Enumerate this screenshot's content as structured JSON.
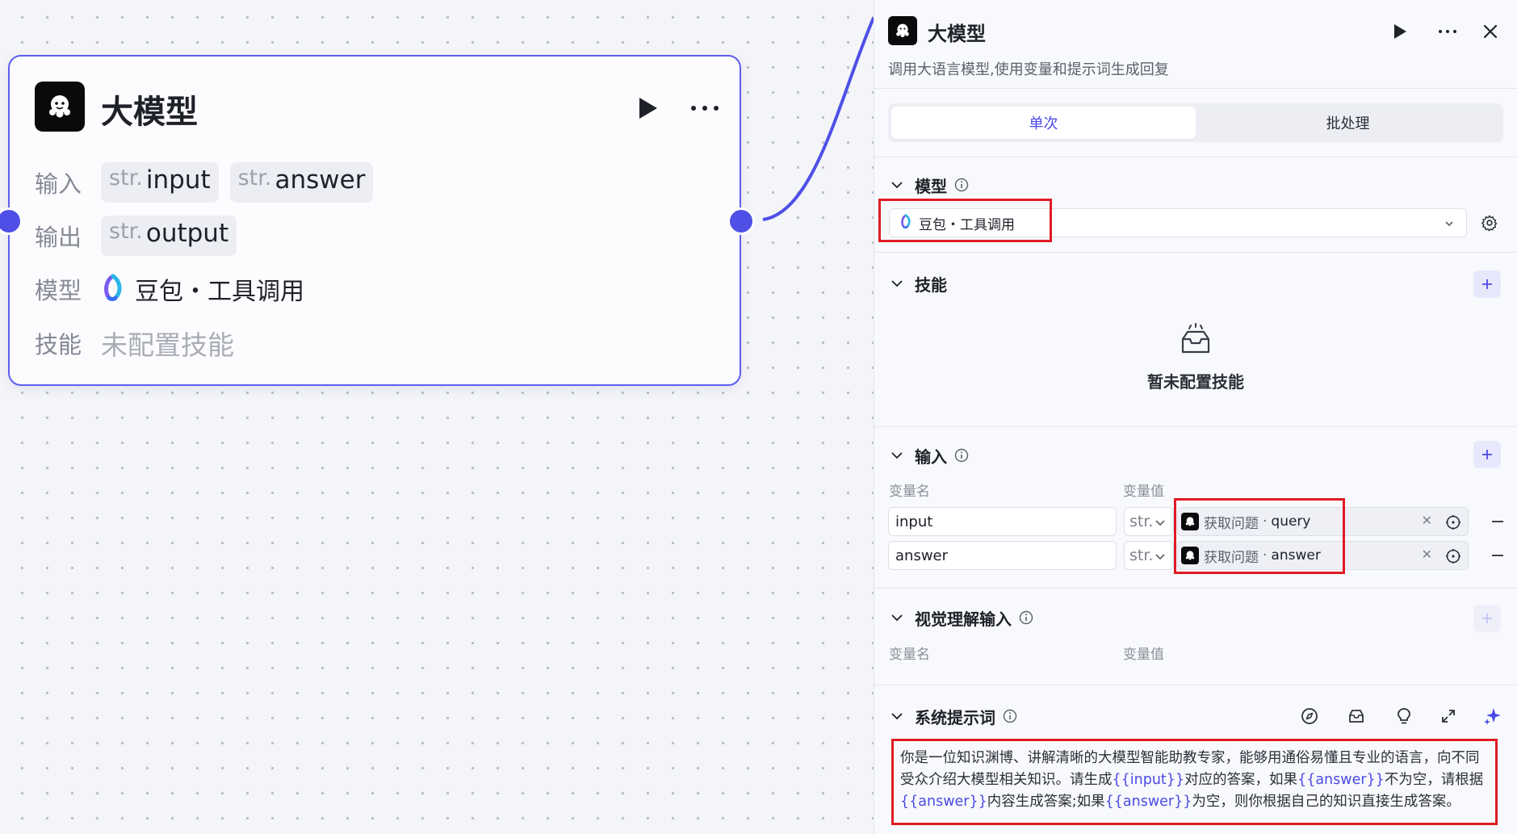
{
  "node": {
    "title": "大模型",
    "input_label": "输入",
    "output_label": "输出",
    "model_label": "模型",
    "skills_label": "技能",
    "inputs": [
      {
        "type": "str.",
        "name": "input"
      },
      {
        "type": "str.",
        "name": "answer"
      }
    ],
    "outputs": [
      {
        "type": "str.",
        "name": "output"
      }
    ],
    "model_name": "豆包・工具调用",
    "skills_value": "未配置技能"
  },
  "panel": {
    "title": "大模型",
    "description": "调用大语言模型,使用变量和提示词生成回复",
    "tabs": [
      {
        "label": "单次",
        "active": true
      },
      {
        "label": "批处理",
        "active": false
      }
    ],
    "model_section": {
      "title": "模型",
      "selected": "豆包・工具调用"
    },
    "skills_section": {
      "title": "技能",
      "empty_text": "暂未配置技能"
    },
    "input_section": {
      "title": "输入",
      "col_name": "变量名",
      "col_value": "变量值",
      "rows": [
        {
          "name": "input",
          "type": "str.",
          "source": "获取问题",
          "separator": "·",
          "variable": "query"
        },
        {
          "name": "answer",
          "type": "str.",
          "source": "获取问题",
          "separator": "·",
          "variable": "answer"
        }
      ]
    },
    "vision_section": {
      "title": "视觉理解输入",
      "col_name": "变量名",
      "col_value": "变量值"
    },
    "prompt_section": {
      "title": "系统提示词",
      "segments": [
        {
          "text": "你是一位知识渊博、讲解清晰的大模型智能助教专家，能够用通俗易懂且专业的语言，向不同受众介绍大模型相关知识。请生成",
          "var": false
        },
        {
          "text": "{{input}}",
          "var": true
        },
        {
          "text": "对应的答案，如果",
          "var": false
        },
        {
          "text": "{{answer}}",
          "var": true
        },
        {
          "text": "不为空，请根据",
          "var": false
        },
        {
          "text": "{{answer}}",
          "var": true
        },
        {
          "text": "内容生成答案;如果",
          "var": false
        },
        {
          "text": "{{answer}}",
          "var": true
        },
        {
          "text": "为空，则你根据自己的知识直接生成答案。",
          "var": false
        }
      ]
    }
  },
  "colors": {
    "accent": "#4f4fe8",
    "highlight_box": "#e01b24",
    "edge": "#4f4fe8"
  }
}
